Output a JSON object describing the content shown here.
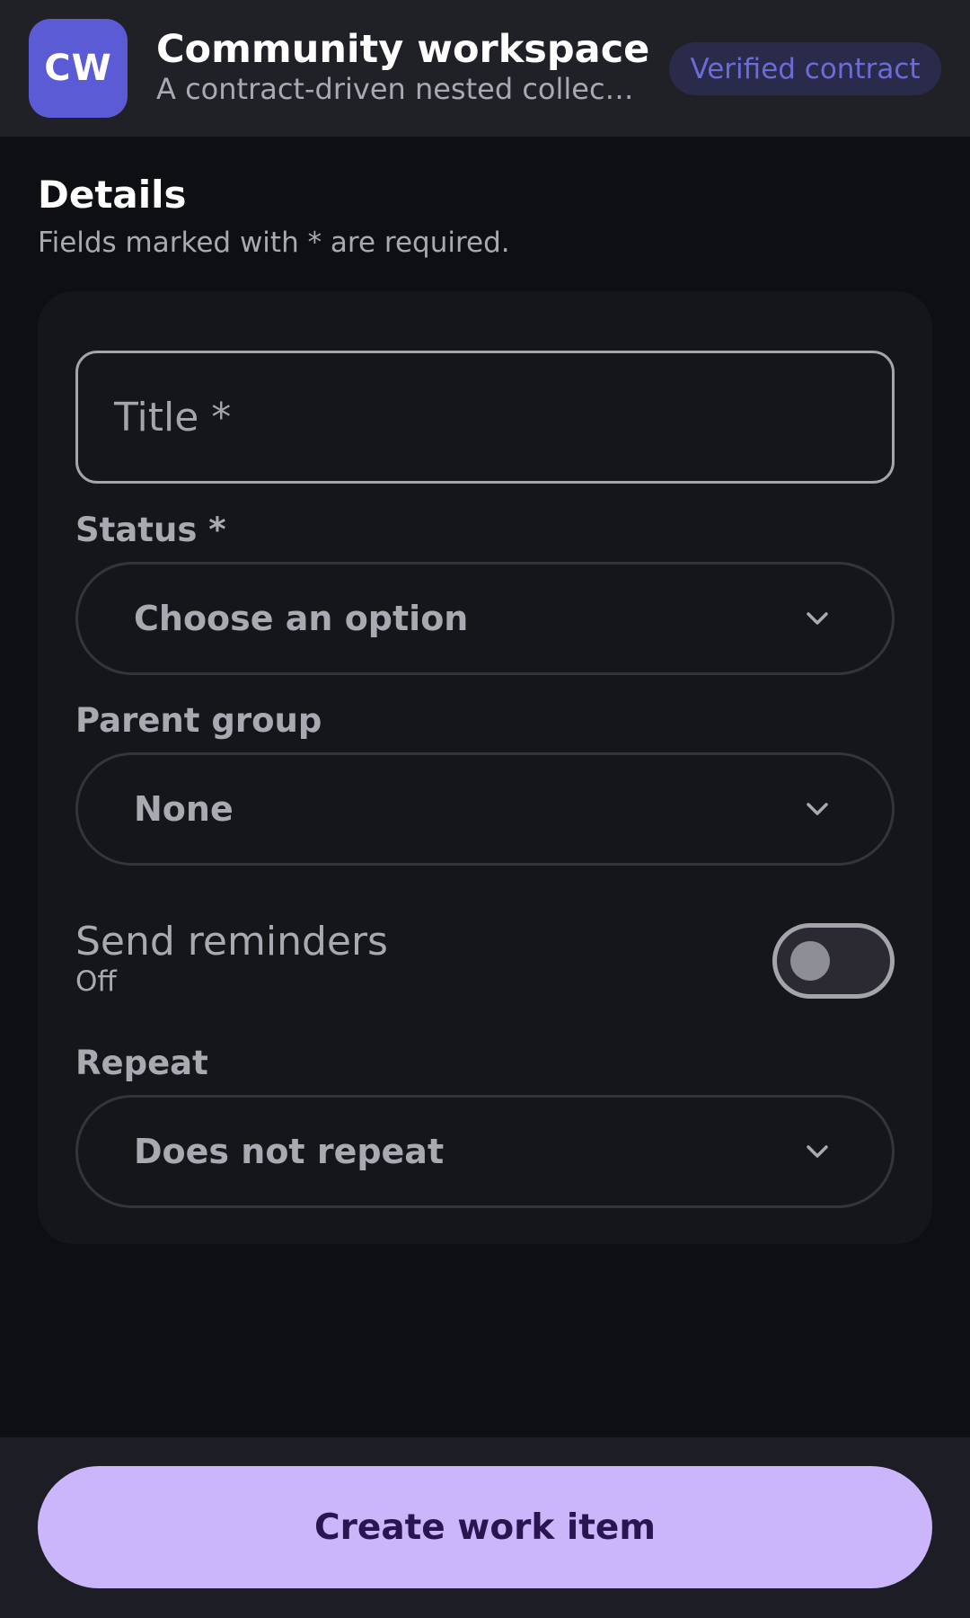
{
  "header": {
    "avatar_initials": "CW",
    "title": "Community workspace",
    "subtitle": "A contract-driven nested collection",
    "badge": "Verified contract",
    "accent_color": "#5b5bd6"
  },
  "section": {
    "heading": "Details",
    "hint": "Fields marked with * are required."
  },
  "form": {
    "title_field": {
      "placeholder": "Title *",
      "value": ""
    },
    "status": {
      "label": "Status *",
      "selected": "Choose an option",
      "icon": "chevron-down-icon"
    },
    "parent_group": {
      "label": "Parent group",
      "selected": "None",
      "icon": "chevron-down-icon"
    },
    "reminders": {
      "label": "Send reminders",
      "state": "Off",
      "on": false
    },
    "repeat": {
      "label": "Repeat",
      "selected": "Does not repeat",
      "icon": "chevron-down-icon"
    }
  },
  "footer": {
    "primary_label": "Create work item",
    "primary_color": "#cbb6fb"
  }
}
